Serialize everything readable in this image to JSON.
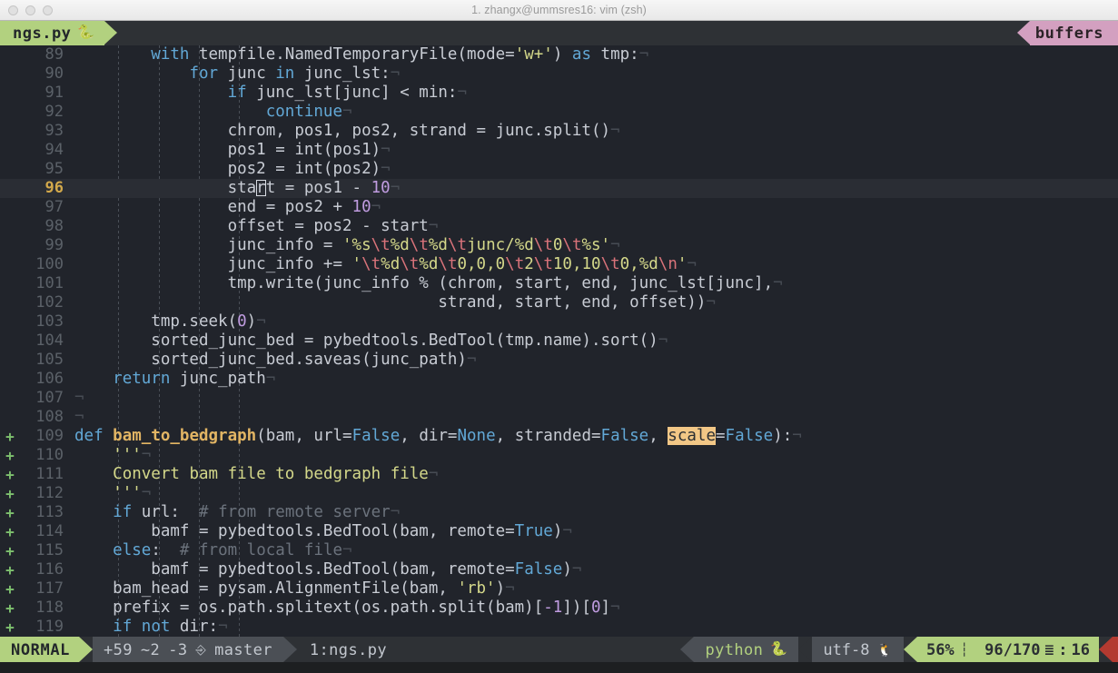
{
  "window": {
    "title": "1. zhangx@ummsres16: vim (zsh)",
    "traffic_lights": [
      "close",
      "minimize",
      "zoom"
    ]
  },
  "tabline": {
    "active_tab": "ngs.py",
    "tab_icon": "python-icon",
    "right_label": "buffers",
    "tab_bg": "#b2d17f",
    "buffers_bg": "#d3a0c0"
  },
  "editor": {
    "filetype": "python",
    "cursor_line": 96,
    "cursor_col": 16,
    "search_term": "scale",
    "eol_marker": "¬",
    "lines": [
      {
        "n": 89,
        "sign": "",
        "tokens": [
          {
            "t": "        ",
            "c": "op"
          },
          {
            "t": "with",
            "c": "kw"
          },
          {
            "t": " tempfile.NamedTemporaryFile(mode=",
            "c": "op"
          },
          {
            "t": "'w+'",
            "c": "str"
          },
          {
            "t": ") ",
            "c": "op"
          },
          {
            "t": "as",
            "c": "kw"
          },
          {
            "t": " tmp:",
            "c": "op"
          },
          {
            "t": "¬",
            "c": "eol"
          }
        ]
      },
      {
        "n": 90,
        "sign": "",
        "tokens": [
          {
            "t": "            ",
            "c": "op"
          },
          {
            "t": "for",
            "c": "kw"
          },
          {
            "t": " junc ",
            "c": "op"
          },
          {
            "t": "in",
            "c": "kw"
          },
          {
            "t": " junc_lst:",
            "c": "op"
          },
          {
            "t": "¬",
            "c": "eol"
          }
        ]
      },
      {
        "n": 91,
        "sign": "",
        "tokens": [
          {
            "t": "                ",
            "c": "op"
          },
          {
            "t": "if",
            "c": "kw"
          },
          {
            "t": " junc_lst[junc] < min:",
            "c": "op"
          },
          {
            "t": "¬",
            "c": "eol"
          }
        ]
      },
      {
        "n": 92,
        "sign": "",
        "tokens": [
          {
            "t": "                    ",
            "c": "op"
          },
          {
            "t": "continue",
            "c": "kw"
          },
          {
            "t": "¬",
            "c": "eol"
          }
        ]
      },
      {
        "n": 93,
        "sign": "",
        "tokens": [
          {
            "t": "                chrom, pos1, pos2, strand = junc.split()",
            "c": "op"
          },
          {
            "t": "¬",
            "c": "eol"
          }
        ]
      },
      {
        "n": 94,
        "sign": "",
        "tokens": [
          {
            "t": "                pos1 = int(pos1)",
            "c": "op"
          },
          {
            "t": "¬",
            "c": "eol"
          }
        ]
      },
      {
        "n": 95,
        "sign": "",
        "tokens": [
          {
            "t": "                pos2 = int(pos2)",
            "c": "op"
          },
          {
            "t": "¬",
            "c": "eol"
          }
        ]
      },
      {
        "n": 96,
        "sign": "",
        "cursorline": true,
        "tokens": [
          {
            "t": "                start = pos1 - ",
            "c": "op"
          },
          {
            "t": "10",
            "c": "num"
          },
          {
            "t": "¬",
            "c": "eol"
          }
        ]
      },
      {
        "n": 97,
        "sign": "",
        "tokens": [
          {
            "t": "                end = pos2 + ",
            "c": "op"
          },
          {
            "t": "10",
            "c": "num"
          },
          {
            "t": "¬",
            "c": "eol"
          }
        ]
      },
      {
        "n": 98,
        "sign": "",
        "tokens": [
          {
            "t": "                offset = pos2 - start",
            "c": "op"
          },
          {
            "t": "¬",
            "c": "eol"
          }
        ]
      },
      {
        "n": 99,
        "sign": "",
        "tokens": [
          {
            "t": "                junc_info = ",
            "c": "op"
          },
          {
            "t": "'%s",
            "c": "str"
          },
          {
            "t": "\\t",
            "c": "esc"
          },
          {
            "t": "%d",
            "c": "str"
          },
          {
            "t": "\\t",
            "c": "esc"
          },
          {
            "t": "%d",
            "c": "str"
          },
          {
            "t": "\\t",
            "c": "esc"
          },
          {
            "t": "junc/%d",
            "c": "str"
          },
          {
            "t": "\\t",
            "c": "esc"
          },
          {
            "t": "0",
            "c": "str"
          },
          {
            "t": "\\t",
            "c": "esc"
          },
          {
            "t": "%s'",
            "c": "str"
          },
          {
            "t": "¬",
            "c": "eol"
          }
        ]
      },
      {
        "n": 100,
        "sign": "",
        "tokens": [
          {
            "t": "                junc_info += ",
            "c": "op"
          },
          {
            "t": "'",
            "c": "str"
          },
          {
            "t": "\\t",
            "c": "esc"
          },
          {
            "t": "%d",
            "c": "str"
          },
          {
            "t": "\\t",
            "c": "esc"
          },
          {
            "t": "%d",
            "c": "str"
          },
          {
            "t": "\\t",
            "c": "esc"
          },
          {
            "t": "0,0,0",
            "c": "str"
          },
          {
            "t": "\\t",
            "c": "esc"
          },
          {
            "t": "2",
            "c": "str"
          },
          {
            "t": "\\t",
            "c": "esc"
          },
          {
            "t": "10,10",
            "c": "str"
          },
          {
            "t": "\\t",
            "c": "esc"
          },
          {
            "t": "0,%d",
            "c": "str"
          },
          {
            "t": "\\n",
            "c": "esc"
          },
          {
            "t": "'",
            "c": "str"
          },
          {
            "t": "¬",
            "c": "eol"
          }
        ]
      },
      {
        "n": 101,
        "sign": "",
        "tokens": [
          {
            "t": "                tmp.write(junc_info % (chrom, start, end, junc_lst[junc],",
            "c": "op"
          },
          {
            "t": "¬",
            "c": "eol"
          }
        ]
      },
      {
        "n": 102,
        "sign": "",
        "tokens": [
          {
            "t": "                                      strand, start, end, offset))",
            "c": "op"
          },
          {
            "t": "¬",
            "c": "eol"
          }
        ]
      },
      {
        "n": 103,
        "sign": "",
        "tokens": [
          {
            "t": "        tmp.seek(",
            "c": "op"
          },
          {
            "t": "0",
            "c": "num"
          },
          {
            "t": ")",
            "c": "op"
          },
          {
            "t": "¬",
            "c": "eol"
          }
        ]
      },
      {
        "n": 104,
        "sign": "",
        "tokens": [
          {
            "t": "        sorted_junc_bed = pybedtools.BedTool(tmp.name).sort()",
            "c": "op"
          },
          {
            "t": "¬",
            "c": "eol"
          }
        ]
      },
      {
        "n": 105,
        "sign": "",
        "tokens": [
          {
            "t": "        sorted_junc_bed.saveas(junc_path)",
            "c": "op"
          },
          {
            "t": "¬",
            "c": "eol"
          }
        ]
      },
      {
        "n": 106,
        "sign": "",
        "tokens": [
          {
            "t": "    ",
            "c": "op"
          },
          {
            "t": "return",
            "c": "kw"
          },
          {
            "t": " junc_path",
            "c": "op"
          },
          {
            "t": "¬",
            "c": "eol"
          }
        ]
      },
      {
        "n": 107,
        "sign": "",
        "tokens": [
          {
            "t": "¬",
            "c": "eol"
          }
        ]
      },
      {
        "n": 108,
        "sign": "",
        "tokens": [
          {
            "t": "¬",
            "c": "eol"
          }
        ]
      },
      {
        "n": 109,
        "sign": "+",
        "tokens": [
          {
            "t": "def",
            "c": "kw"
          },
          {
            "t": " ",
            "c": "op"
          },
          {
            "t": "bam_to_bedgraph",
            "c": "fn"
          },
          {
            "t": "(bam, url=",
            "c": "op"
          },
          {
            "t": "False",
            "c": "builtin"
          },
          {
            "t": ", dir=",
            "c": "op"
          },
          {
            "t": "None",
            "c": "builtin"
          },
          {
            "t": ", stranded=",
            "c": "op"
          },
          {
            "t": "False",
            "c": "builtin"
          },
          {
            "t": ", ",
            "c": "op"
          },
          {
            "t": "scale",
            "c": "search-hl"
          },
          {
            "t": "=",
            "c": "op"
          },
          {
            "t": "False",
            "c": "builtin"
          },
          {
            "t": "):",
            "c": "op"
          },
          {
            "t": "¬",
            "c": "eol"
          }
        ]
      },
      {
        "n": 110,
        "sign": "+",
        "tokens": [
          {
            "t": "    ",
            "c": "op"
          },
          {
            "t": "'''",
            "c": "str"
          },
          {
            "t": "¬",
            "c": "eol"
          }
        ]
      },
      {
        "n": 111,
        "sign": "+",
        "tokens": [
          {
            "t": "    ",
            "c": "op"
          },
          {
            "t": "Convert bam file to bedgraph file",
            "c": "str"
          },
          {
            "t": "¬",
            "c": "eol"
          }
        ]
      },
      {
        "n": 112,
        "sign": "+",
        "tokens": [
          {
            "t": "    ",
            "c": "op"
          },
          {
            "t": "'''",
            "c": "str"
          },
          {
            "t": "¬",
            "c": "eol"
          }
        ]
      },
      {
        "n": 113,
        "sign": "+",
        "tokens": [
          {
            "t": "    ",
            "c": "op"
          },
          {
            "t": "if",
            "c": "kw"
          },
          {
            "t": " url:  ",
            "c": "op"
          },
          {
            "t": "# from remote server",
            "c": "com"
          },
          {
            "t": "¬",
            "c": "eol"
          }
        ]
      },
      {
        "n": 114,
        "sign": "+",
        "tokens": [
          {
            "t": "        bamf = pybedtools.BedTool(bam, remote=",
            "c": "op"
          },
          {
            "t": "True",
            "c": "builtin"
          },
          {
            "t": ")",
            "c": "op"
          },
          {
            "t": "¬",
            "c": "eol"
          }
        ]
      },
      {
        "n": 115,
        "sign": "+",
        "tokens": [
          {
            "t": "    ",
            "c": "op"
          },
          {
            "t": "else",
            "c": "kw"
          },
          {
            "t": ":  ",
            "c": "op"
          },
          {
            "t": "# from local file",
            "c": "com"
          },
          {
            "t": "¬",
            "c": "eol"
          }
        ]
      },
      {
        "n": 116,
        "sign": "+",
        "tokens": [
          {
            "t": "        bamf = pybedtools.BedTool(bam, remote=",
            "c": "op"
          },
          {
            "t": "False",
            "c": "builtin"
          },
          {
            "t": ")",
            "c": "op"
          },
          {
            "t": "¬",
            "c": "eol"
          }
        ]
      },
      {
        "n": 117,
        "sign": "+",
        "tokens": [
          {
            "t": "    bam_head = pysam.AlignmentFile(bam, ",
            "c": "op"
          },
          {
            "t": "'rb'",
            "c": "str"
          },
          {
            "t": ")",
            "c": "op"
          },
          {
            "t": "¬",
            "c": "eol"
          }
        ]
      },
      {
        "n": 118,
        "sign": "+",
        "tokens": [
          {
            "t": "    prefix = os.path.splitext(os.path.split(bam)[",
            "c": "op"
          },
          {
            "t": "-1",
            "c": "num"
          },
          {
            "t": "])[",
            "c": "op"
          },
          {
            "t": "0",
            "c": "num"
          },
          {
            "t": "]",
            "c": "op"
          },
          {
            "t": "¬",
            "c": "eol"
          }
        ]
      },
      {
        "n": 119,
        "sign": "+",
        "tokens": [
          {
            "t": "    ",
            "c": "op"
          },
          {
            "t": "if",
            "c": "kw"
          },
          {
            "t": " ",
            "c": "op"
          },
          {
            "t": "not",
            "c": "kw"
          },
          {
            "t": " dir:",
            "c": "op"
          },
          {
            "t": "¬",
            "c": "eol"
          }
        ]
      }
    ]
  },
  "statusline": {
    "mode": "NORMAL",
    "git_added": "+59",
    "git_modified": "~2",
    "git_removed": "-3",
    "branch_icon": "git-branch-icon",
    "branch": "master",
    "buffer": "1:ngs.py",
    "filetype": "python",
    "filetype_icon": "python-icon",
    "encoding": "utf-8",
    "encoding_icon": "linux-penguin-icon",
    "percent": "56%",
    "scroll_icon": "scroll-indicator-icon",
    "position": "96/170",
    "lines_icon": "lines-icon",
    "column_sep": ":",
    "column": "16"
  }
}
